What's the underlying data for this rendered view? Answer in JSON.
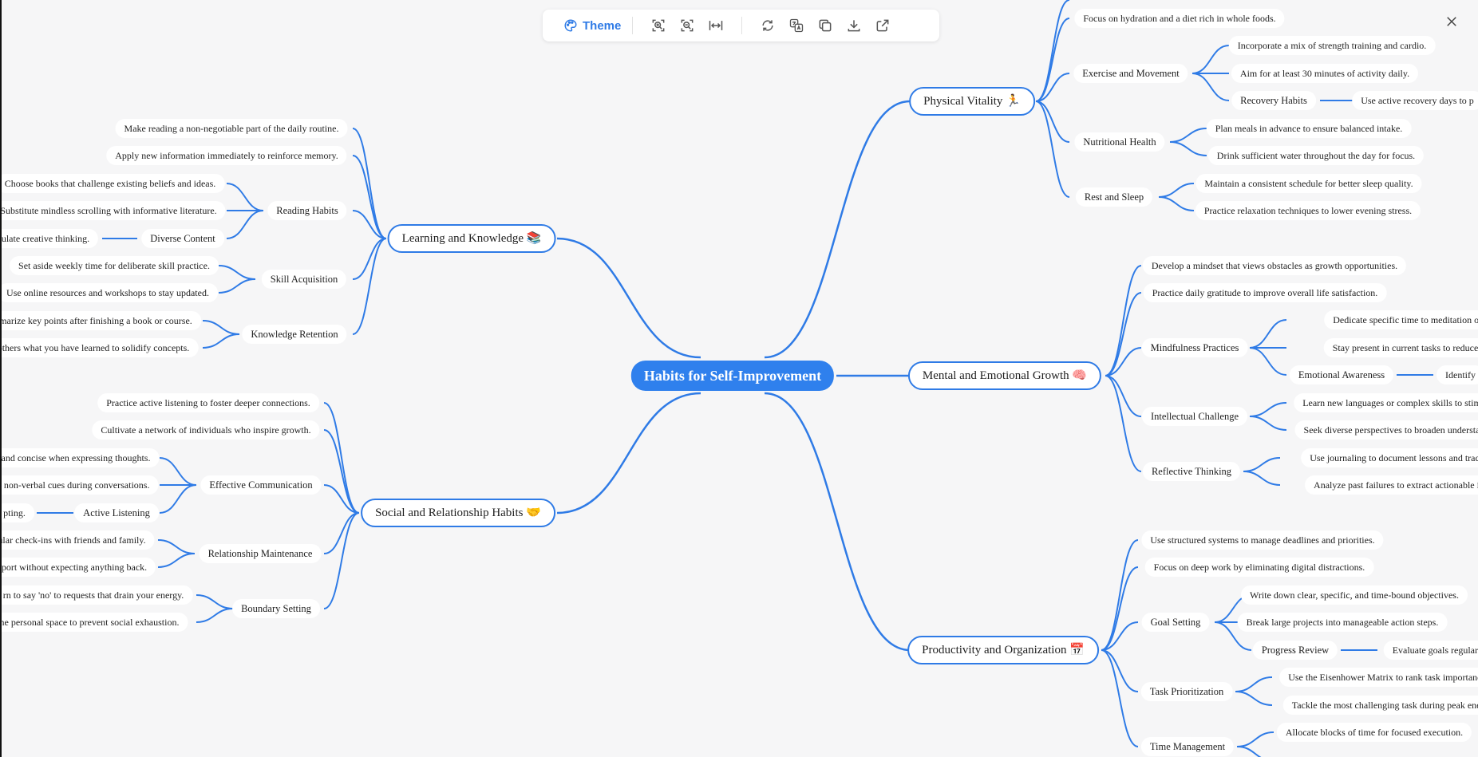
{
  "toolbar": {
    "theme_label": "Theme",
    "buttons": [
      "zoom-in-icon",
      "zoom-out-icon",
      "fit-width-icon",
      "refresh-icon",
      "translate-icon",
      "copy-icon",
      "download-icon",
      "share-icon"
    ]
  },
  "colors": {
    "accent": "#2f7be6",
    "root_fill": "#2f80ed",
    "background": "#f6f6f7"
  },
  "mindmap": {
    "root": "Habits for Self-Improvement",
    "branches": [
      {
        "label": "Physical Vitality 🏃",
        "children": [
          {
            "label": "Focus on hydration and a diet rich in whole foods."
          },
          {
            "label": "Exercise and Movement",
            "children": [
              {
                "label": "Incorporate a mix of strength training and cardio."
              },
              {
                "label": "Aim for at least 30 minutes of activity daily."
              },
              {
                "label": "Recovery Habits",
                "children": [
                  {
                    "label": "Use active recovery days to p"
                  }
                ]
              }
            ]
          },
          {
            "label": "Nutritional Health",
            "children": [
              {
                "label": "Plan meals in advance to ensure balanced intake."
              },
              {
                "label": "Drink sufficient water throughout the day for focus."
              }
            ]
          },
          {
            "label": "Rest and Sleep",
            "children": [
              {
                "label": "Maintain a consistent schedule for better sleep quality."
              },
              {
                "label": "Practice relaxation techniques to lower evening stress."
              }
            ]
          }
        ]
      },
      {
        "label": "Mental and Emotional Growth 🧠",
        "children": [
          {
            "label": "Develop a mindset that views obstacles as growth opportunities."
          },
          {
            "label": "Practice daily gratitude to improve overall life satisfaction."
          },
          {
            "label": "Mindfulness Practices",
            "children": [
              {
                "label": "Dedicate specific time to meditation or deep br"
              },
              {
                "label": "Stay present in current tasks to reduce mental c"
              },
              {
                "label": "Emotional Awareness",
                "children": [
                  {
                    "label": "Identify"
                  }
                ]
              }
            ]
          },
          {
            "label": "Intellectual Challenge",
            "children": [
              {
                "label": "Learn new languages or complex skills to stimu"
              },
              {
                "label": "Seek diverse perspectives to broaden understan"
              }
            ]
          },
          {
            "label": "Reflective Thinking",
            "children": [
              {
                "label": "Use journaling to document lessons and track pro"
              },
              {
                "label": "Analyze past failures to extract actionable insigh"
              }
            ]
          }
        ]
      },
      {
        "label": "Productivity and Organization 📅",
        "children": [
          {
            "label": "Use structured systems to manage deadlines and priorities."
          },
          {
            "label": "Focus on deep work by eliminating digital distractions."
          },
          {
            "label": "Goal Setting",
            "children": [
              {
                "label": "Write down clear, specific, and time-bound objectives."
              },
              {
                "label": "Break large projects into manageable action steps."
              },
              {
                "label": "Progress Review",
                "children": [
                  {
                    "label": "Evaluate goals regularl"
                  }
                ]
              }
            ]
          },
          {
            "label": "Task Prioritization",
            "children": [
              {
                "label": "Use the Eisenhower Matrix to rank task importance"
              },
              {
                "label": "Tackle the most challenging task during peak energ"
              }
            ]
          },
          {
            "label": "Time Management",
            "children": [
              {
                "label": "Allocate blocks of time for focused execution."
              },
              {
                "label": ""
              }
            ]
          }
        ]
      },
      {
        "label": "Learning and Knowledge 📚",
        "children": [
          {
            "label": "Make reading a non-negotiable part of the daily routine."
          },
          {
            "label": "Apply new information immediately to reinforce memory."
          },
          {
            "label": "Reading Habits",
            "children": [
              {
                "label": "Choose books that challenge existing beliefs and ideas."
              },
              {
                "label": "Substitute mindless scrolling with informative literature."
              },
              {
                "label": "Diverse Content",
                "children": [
                  {
                    "label": "ulate creative thinking."
                  }
                ]
              }
            ]
          },
          {
            "label": "Skill Acquisition",
            "children": [
              {
                "label": "Set aside weekly time for deliberate skill practice."
              },
              {
                "label": "Use online resources and workshops to stay updated."
              }
            ]
          },
          {
            "label": "Knowledge Retention",
            "children": [
              {
                "label": "marize key points after finishing a book or course."
              },
              {
                "label": "others what you have learned to solidify concepts."
              }
            ]
          }
        ]
      },
      {
        "label": "Social and Relationship Habits 🤝",
        "children": [
          {
            "label": "Practice active listening to foster deeper connections."
          },
          {
            "label": "Cultivate a network of individuals who inspire growth."
          },
          {
            "label": "Effective Communication",
            "children": [
              {
                "label": "and concise when expressing thoughts."
              },
              {
                "label": "e non-verbal cues during conversations."
              },
              {
                "label": "Active Listening",
                "children": [
                  {
                    "label": "pting."
                  }
                ]
              }
            ]
          },
          {
            "label": "Relationship Maintenance",
            "children": [
              {
                "label": "ular check-ins with friends and family."
              },
              {
                "label": "pport without expecting anything back."
              }
            ]
          },
          {
            "label": "Boundary Setting",
            "children": [
              {
                "label": "rn to say 'no' to requests that drain your energy."
              },
              {
                "label": "ne personal space to prevent social exhaustion."
              }
            ]
          }
        ]
      }
    ]
  }
}
